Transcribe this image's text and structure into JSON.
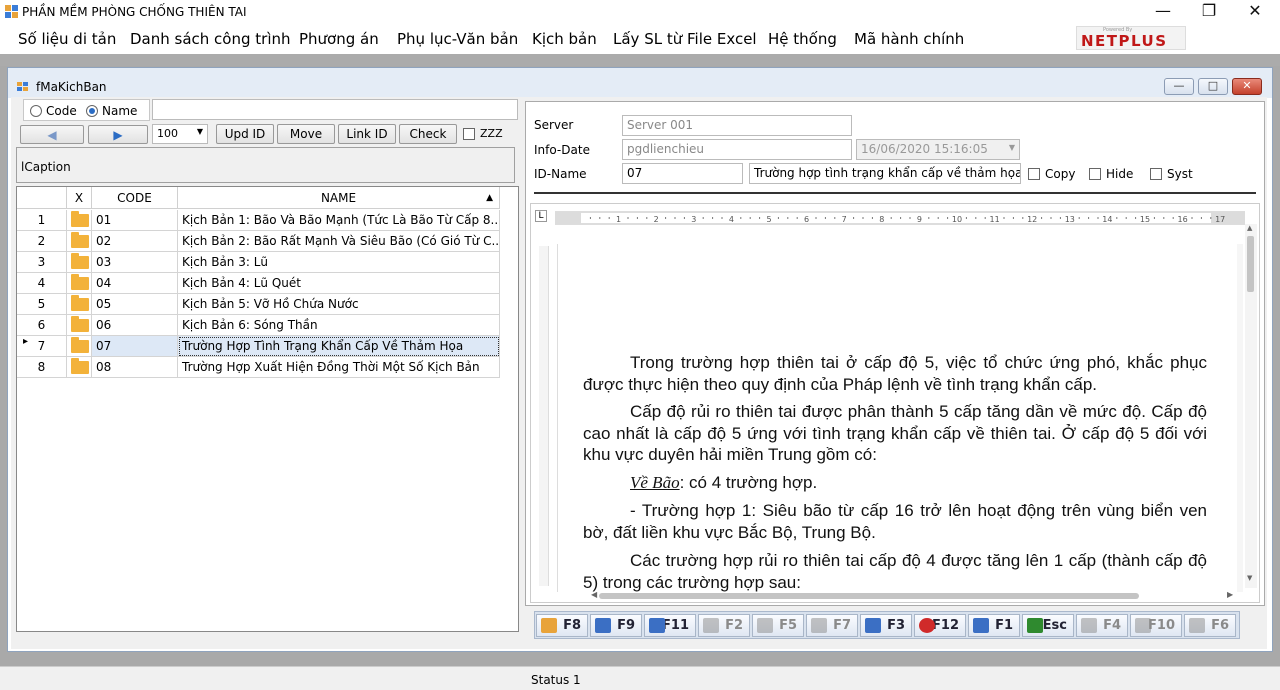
{
  "window": {
    "title": "PHẦN MỀM PHÒNG CHỐNG THIÊN TAI"
  },
  "menu": [
    "Số liệu di tản",
    "Danh sách công trình",
    "Phương án",
    "Phụ lục-Văn bản",
    "Kịch bản",
    "Lấy  SL từ File Excel",
    "Hệ thống",
    "Mã hành chính"
  ],
  "brand": {
    "powered": "Powered By",
    "logo": "NETPLUS",
    "color": "#c01818"
  },
  "child_window": {
    "title": "fMaKichBan"
  },
  "left": {
    "radio_code": "Code",
    "radio_name": "Name",
    "radio_selected": "Name",
    "search_value": "",
    "page_size": "100",
    "btn_upd": "Upd ID",
    "btn_move": "Move",
    "btn_link": "Link ID",
    "btn_check": "Check",
    "chk_zzz": "ZZZ",
    "caption": "lCaption"
  },
  "grid": {
    "headers": [
      "X",
      "CODE",
      "NAME"
    ],
    "selected_row": 7,
    "rows": [
      {
        "num": "1",
        "code": "01",
        "name": "Kịch Bản 1: Bão Và Bão Mạnh (Tức Là Bão Từ Cấp 8..."
      },
      {
        "num": "2",
        "code": "02",
        "name": "Kịch Bản 2: Bão Rất Mạnh Và Siêu Bão (Có Gió Từ C..."
      },
      {
        "num": "3",
        "code": "03",
        "name": "Kịch Bản 3: Lũ"
      },
      {
        "num": "4",
        "code": "04",
        "name": "Kịch Bản 4: Lũ Quét"
      },
      {
        "num": "5",
        "code": "05",
        "name": "Kịch Bản 5: Vỡ Hồ Chứa Nước"
      },
      {
        "num": "6",
        "code": "06",
        "name": "Kịch Bản 6: Sóng Thần"
      },
      {
        "num": "7",
        "code": "07",
        "name": "Trường Hợp Tình Trạng Khẩn Cấp Về Thảm Họa"
      },
      {
        "num": "8",
        "code": "08",
        "name": "Trường Hợp Xuất Hiện Đồng Thời Một Số Kịch Bản"
      }
    ]
  },
  "right": {
    "server_label": "Server",
    "server_value": "Server 001",
    "info_label": "Info-Date",
    "info_value": "pgdlienchieu",
    "date_value": "16/06/2020 15:16:05",
    "idname_label": "ID-Name",
    "id_value": "07",
    "name_value": "Trường hợp tình trạng khẩn cấp về thảm họa",
    "chk_copy": "Copy",
    "chk_hide": "Hide",
    "chk_syst": "Syst"
  },
  "document": {
    "p1": "Trong trường hợp thiên tai ở cấp độ 5, việc tổ chức ứng phó, khắc phục được thực hiện theo quy định của Pháp lệnh về tình trạng khẩn cấp.",
    "p2": "Cấp độ rủi ro thiên tai được phân thành 5 cấp tăng dần về mức độ. Cấp độ cao nhất là cấp độ 5 ứng với tình trạng khẩn cấp về thiên tai. Ở cấp độ 5 đối với khu vực duyên hải miền Trung gồm có:",
    "p3_label": "Về Bão",
    "p3_rest": ":  có 4 trường hợp.",
    "p4": "- Trường hợp 1: Siêu bão từ cấp 16 trở lên hoạt động trên vùng biển ven bờ, đất liền khu vực Bắc Bộ, Trung Bộ.",
    "p5": "Các trường hợp rủi ro thiên tai cấp độ 4 được tăng lên 1 cấp (thành cấp độ 5) trong các trường hợp sau:"
  },
  "ruler_marks": [
    "1",
    "2",
    "3",
    "4",
    "5",
    "6",
    "7",
    "8",
    "9",
    "10",
    "11",
    "12",
    "13",
    "14",
    "15",
    "16",
    "17"
  ],
  "toolbar": [
    "F8",
    "F9",
    "F11",
    "F2",
    "F5",
    "F7",
    "F3",
    "F12",
    "F1",
    "Esc",
    "F4",
    "F10",
    "F6"
  ],
  "status": "Status 1"
}
